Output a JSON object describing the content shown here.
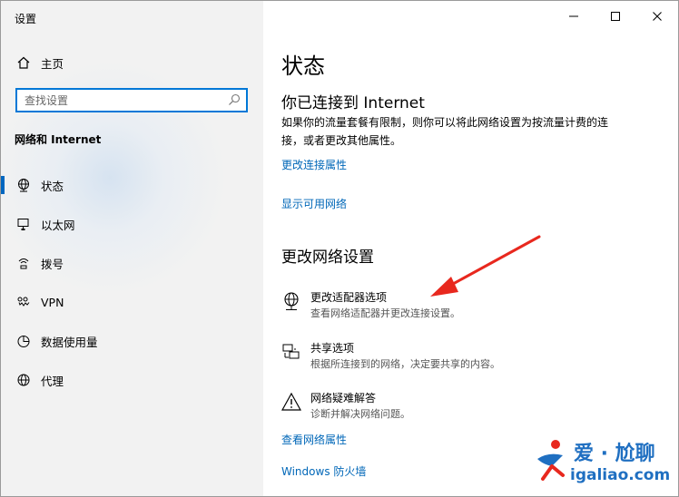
{
  "window": {
    "title": "设置"
  },
  "sidebar": {
    "home_label": "主页",
    "search_placeholder": "查找设置",
    "section_title": "网络和 Internet",
    "items": [
      {
        "label": "状态",
        "icon": "globe-icon",
        "active": true
      },
      {
        "label": "以太网",
        "icon": "ethernet-icon"
      },
      {
        "label": "拨号",
        "icon": "dialup-icon"
      },
      {
        "label": "VPN",
        "icon": "vpn-icon"
      },
      {
        "label": "数据使用量",
        "icon": "data-usage-icon"
      },
      {
        "label": "代理",
        "icon": "proxy-globe-icon"
      }
    ]
  },
  "main": {
    "title": "状态",
    "connected_heading": "你已连接到 Internet",
    "connected_desc": "如果你的流量套餐有限制，则你可以将此网络设置为按流量计费的连接，或者更改其他属性。",
    "link_change_props": "更改连接属性",
    "link_show_networks": "显示可用网络",
    "change_heading": "更改网络设置",
    "options": [
      {
        "title": "更改适配器选项",
        "desc": "查看网络适配器并更改连接设置。",
        "icon": "adapter-globe-icon"
      },
      {
        "title": "共享选项",
        "desc": "根据所连接到的网络，决定要共享的内容。",
        "icon": "sharing-icon"
      },
      {
        "title": "网络疑难解答",
        "desc": "诊断并解决网络问题。",
        "icon": "warning-icon"
      }
    ],
    "link_view_props": "查看网络属性",
    "link_firewall": "Windows 防火墙"
  },
  "watermark": {
    "cn": "爱 · 尬聊",
    "url": "igaliao.com"
  },
  "colors": {
    "accent": "#0067c0",
    "link": "#0067b8",
    "arrow": "#e8281e",
    "watermark": "#1f6fc1"
  }
}
